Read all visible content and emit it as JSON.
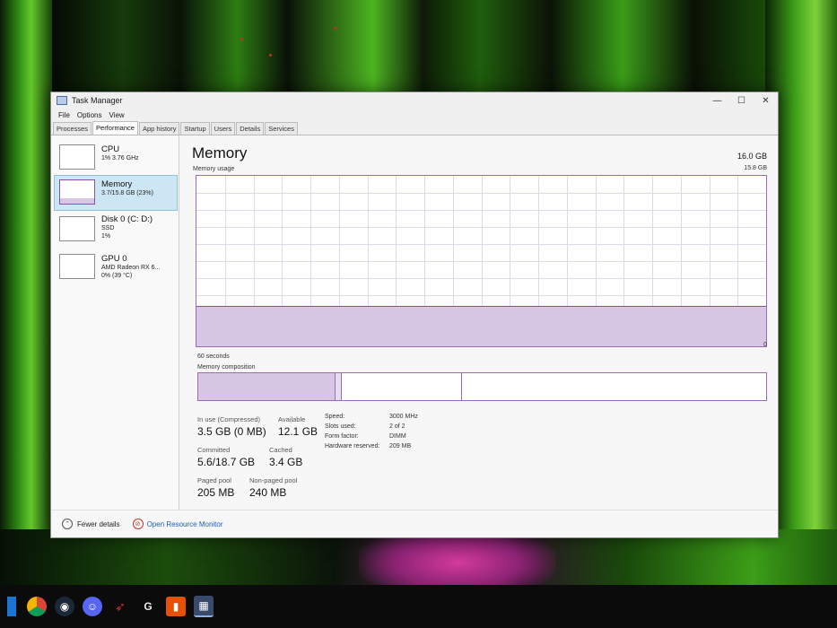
{
  "window": {
    "title": "Task Manager",
    "controls": [
      "—",
      "☐",
      "✕"
    ]
  },
  "menu": [
    "File",
    "Options",
    "View"
  ],
  "tabs": [
    "Processes",
    "Performance",
    "App history",
    "Startup",
    "Users",
    "Details",
    "Services"
  ],
  "active_tab": "Performance",
  "sidebar": {
    "items": [
      {
        "name": "CPU",
        "line1": "1% 3.76 GHz",
        "line2": ""
      },
      {
        "name": "Memory",
        "line1": "3.7/15.8 GB (23%)",
        "line2": ""
      },
      {
        "name": "Disk 0 (C: D:)",
        "line1": "SSD",
        "line2": "1%"
      },
      {
        "name": "GPU 0",
        "line1": "AMD Radeon RX 6...",
        "line2": "0% (39 °C)"
      }
    ],
    "selected": "Memory"
  },
  "memory": {
    "title": "Memory",
    "total": "16.0 GB",
    "usage_label": "Memory usage",
    "usage_max": "15.8 GB",
    "axis_left": "60 seconds",
    "axis_right": "0",
    "usage_fraction": 0.23,
    "composition_label": "Memory composition",
    "stats": {
      "in_use_label": "In use (Compressed)",
      "in_use_value": "3.5 GB (0 MB)",
      "available_label": "Available",
      "available_value": "12.1 GB",
      "committed_label": "Committed",
      "committed_value": "5.6/18.7 GB",
      "cached_label": "Cached",
      "cached_value": "3.4 GB",
      "paged_label": "Paged pool",
      "paged_value": "205 MB",
      "nonpaged_label": "Non-paged pool",
      "nonpaged_value": "240 MB"
    },
    "details": {
      "speed_label": "Speed:",
      "speed_value": "3000 MHz",
      "slots_label": "Slots used:",
      "slots_value": "2 of 2",
      "form_label": "Form factor:",
      "form_value": "DIMM",
      "reserved_label": "Hardware reserved:",
      "reserved_value": "209 MB"
    }
  },
  "footer": {
    "fewer_details": "Fewer details",
    "resource_monitor": "Open Resource Monitor"
  },
  "colors": {
    "memory_accent": "#8b4fa8",
    "memory_fill": "#d7c6e4",
    "selected_bg": "#cde6f3",
    "link": "#1b5fb8"
  }
}
